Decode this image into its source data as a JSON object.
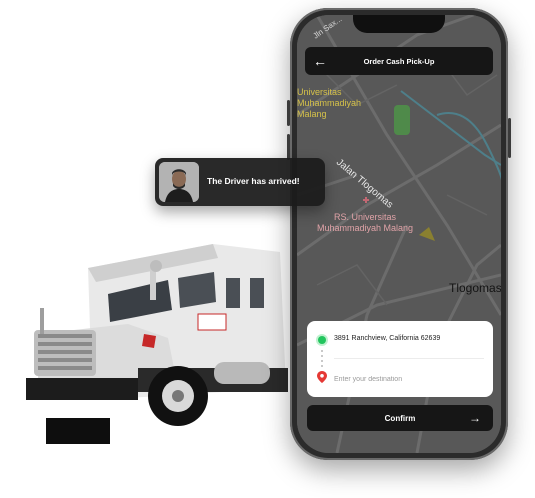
{
  "header": {
    "title": "Order Cash Pick-Up",
    "back_icon": "arrow-left-icon"
  },
  "notification": {
    "message": "The Driver has arrived!",
    "avatar_icon": "driver-avatar"
  },
  "map": {
    "labels": {
      "top": "Jln Sax...",
      "university": "Universitas\nMuhammadiyah\nMalang",
      "street": "Jalan Tlogomas",
      "hospital": "RS. Universitas\nMuhammadiyah Malang",
      "district": "Tlogomas"
    }
  },
  "route": {
    "pickup_address": "3891 Ranchview, California 62639",
    "destination_value": "",
    "destination_placeholder": "Enter your destination"
  },
  "confirm": {
    "label": "Confirm",
    "icon": "arrow-right-icon"
  },
  "colors": {
    "accent_green": "#22c55e",
    "destination_red": "#e53935",
    "dark": "#161616"
  }
}
